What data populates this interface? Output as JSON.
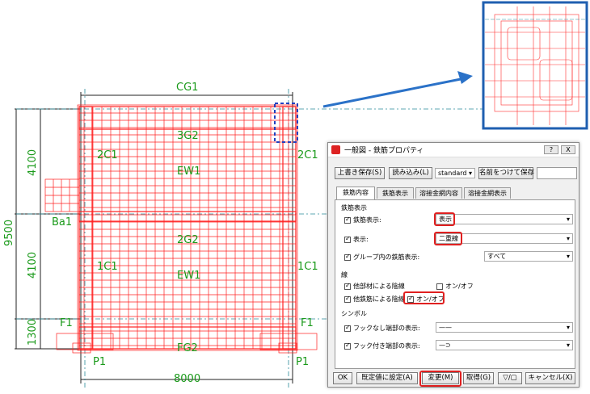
{
  "drawing": {
    "labels": {
      "cg1": "CG1",
      "g3g2": "3G2",
      "ew1_top": "EW1",
      "c2c1_left": "2C1",
      "c2c1_right": "2C1",
      "ba1": "Ba1",
      "g2g2": "2G2",
      "c1c1_left": "1C1",
      "c1c1_right": "1C1",
      "ew1_bottom": "EW1",
      "f1_left": "F1",
      "f1_right": "F1",
      "fg2": "FG2",
      "p1_left": "P1",
      "p1_right": "P1",
      "dim_8000": "8000",
      "dim_9500": "9500",
      "dim_4100_top": "4100",
      "dim_4100_bottom": "4100",
      "dim_1300": "1300"
    },
    "colors": {
      "rebar": "#ff2020",
      "dim_text": "#1a9a1a",
      "callout": "#2060d0"
    }
  },
  "dialog": {
    "title": "一般図 - 鉄筋プロパティ",
    "title_buttons": [
      "?",
      "X"
    ],
    "toolbar": {
      "overwrite_save": "上書き保存(S)",
      "load": "読み込み(L)",
      "preset_value": "standard",
      "save_as": "名前をつけて保存"
    },
    "tabs": [
      "鉄筋内容",
      "鉄筋表示",
      "溶接金網内容",
      "溶接金網表示"
    ],
    "sections": {
      "rebar_display": "鉄筋表示",
      "lines": "線",
      "symbols": "シンボル"
    },
    "rows": {
      "rebar_display_label": "鉄筋表示:",
      "rebar_display_value": "表示",
      "display_label": "表示:",
      "display_value": "二重線",
      "group_label": "グループ内の鉄筋表示:",
      "group_value": "すべて",
      "hidden_by_member": "他部材による陰線",
      "onoff1": "オン/オフ",
      "hidden_by_rebar": "他鉄筋による陰線",
      "onoff2": "オン/オフ",
      "hookless_end": "フックなし端部の表示:",
      "hooked_end": "フック付き端部の表示:"
    },
    "footer": {
      "ok": "OK",
      "set_default": "既定値に設定(A)",
      "modify": "変更(M)",
      "get": "取得(G)",
      "toggle": "▽/▢",
      "cancel": "キャンセル(X)"
    }
  }
}
